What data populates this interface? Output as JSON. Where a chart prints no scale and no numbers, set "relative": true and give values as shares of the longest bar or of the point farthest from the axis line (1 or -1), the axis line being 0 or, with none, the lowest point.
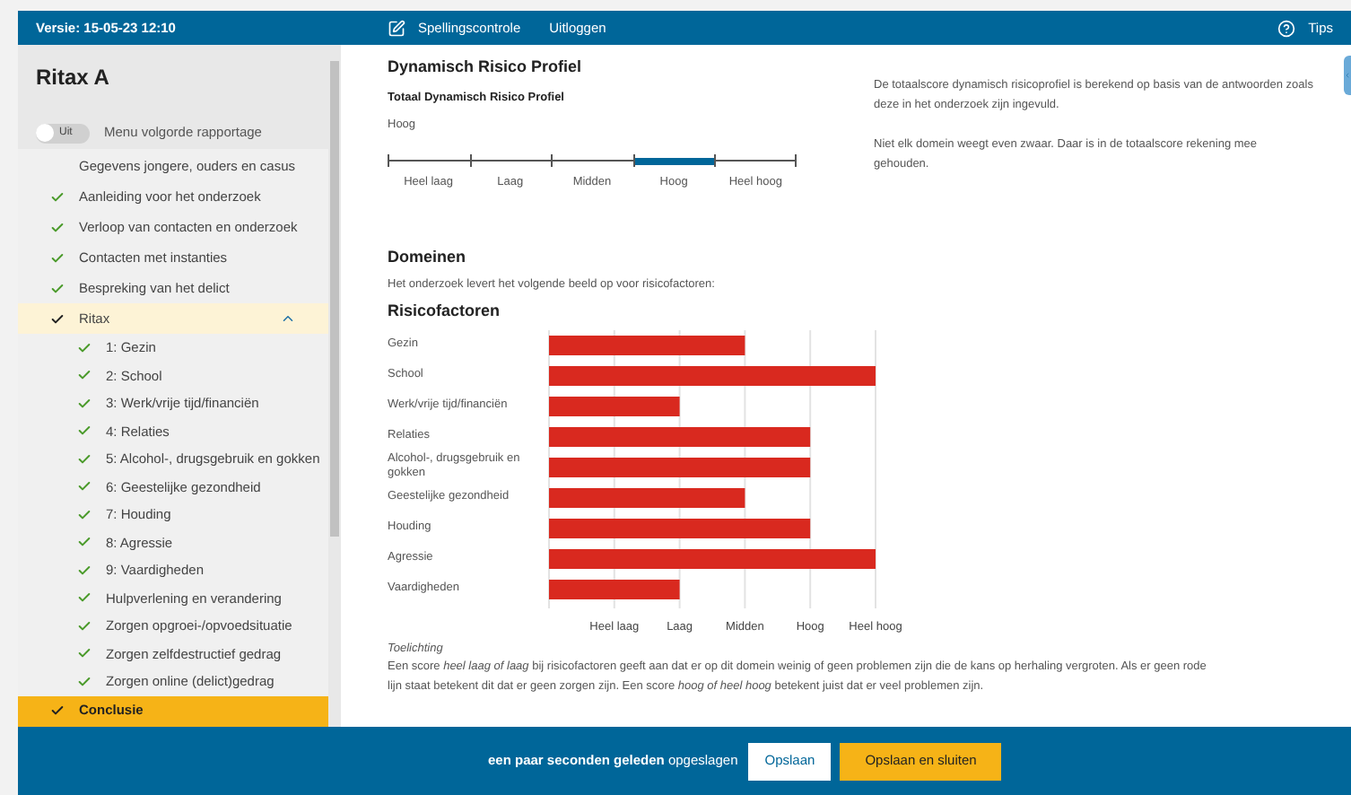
{
  "header": {
    "version": "Versie: 15-05-23 12:10",
    "links": [
      "Spellingscontrole",
      "Uitloggen"
    ],
    "tips": "Tips"
  },
  "sidebar": {
    "title": "Ritax A",
    "toggle": {
      "state": "Uit",
      "on": false,
      "label": "Menu volgorde rapportage"
    },
    "items": [
      {
        "label": "Gegevens jongere, ouders en casus",
        "checked": false,
        "selected": false
      },
      {
        "label": "Aanleiding voor het onderzoek",
        "checked": true,
        "selected": false
      },
      {
        "label": "Verloop van contacten en onderzoek",
        "checked": true,
        "selected": false
      },
      {
        "label": "Contacten met instanties",
        "checked": true,
        "selected": false
      },
      {
        "label": "Bespreking van het delict",
        "checked": true,
        "selected": false
      },
      {
        "label": "Ritax",
        "checked": true,
        "selected": false,
        "expanded": true,
        "children": [
          {
            "label": "1: Gezin",
            "checked": true,
            "selected": false
          },
          {
            "label": "2: School",
            "checked": true,
            "selected": false
          },
          {
            "label": "3: Werk/vrije tijd/financiën",
            "checked": true,
            "selected": false
          },
          {
            "label": "4: Relaties",
            "checked": true,
            "selected": false
          },
          {
            "label": "5: Alcohol-, drugsgebruik en gokken",
            "checked": true,
            "selected": false
          },
          {
            "label": "6: Geestelijke gezondheid",
            "checked": true,
            "selected": false
          },
          {
            "label": "7: Houding",
            "checked": true,
            "selected": false
          },
          {
            "label": "8: Agressie",
            "checked": true,
            "selected": false
          },
          {
            "label": "9: Vaardigheden",
            "checked": true,
            "selected": false
          },
          {
            "label": "Hulpverlening en verandering",
            "checked": true,
            "selected": false
          },
          {
            "label": "Zorgen opgroei-/opvoedsituatie",
            "checked": true,
            "selected": false
          },
          {
            "label": "Zorgen zelfdestructief gedrag",
            "checked": true,
            "selected": false
          },
          {
            "label": "Zorgen online (delict)gedrag",
            "checked": true,
            "selected": false
          }
        ]
      },
      {
        "label": "Conclusie",
        "checked": true,
        "selected": true
      }
    ]
  },
  "profile": {
    "title": "Dynamisch Risico Profiel",
    "subtitle": "Totaal Dynamisch Risico Profiel",
    "value": "Hoog",
    "segments": [
      {
        "label": "Heel laag",
        "selected": false
      },
      {
        "label": "Laag",
        "selected": false
      },
      {
        "label": "Midden",
        "selected": false
      },
      {
        "label": "Hoog",
        "selected": true
      },
      {
        "label": "Heel hoog",
        "selected": false
      }
    ],
    "info": [
      "De totaalscore dynamisch risicoprofiel is berekend op basis van de antwoorden zoals deze in het onderzoek zijn ingevuld.",
      "Niet elk domein weegt even zwaar. Daar is in de totaalscore rekening mee gehouden."
    ]
  },
  "domains": {
    "title": "Domeinen",
    "intro": "Het onderzoek levert het volgende beeld op voor risicofactoren:",
    "chart_data": {
      "type": "bar",
      "orientation": "horizontal",
      "title": "Risicofactoren",
      "categories": [
        "Gezin",
        "School",
        "Werk/vrije tijd/financiën",
        "Relaties",
        "Alcohol-, drugsgebruik en gokken",
        "Geestelijke gezondheid",
        "Houding",
        "Agressie",
        "Vaardigheden"
      ],
      "values": [
        0.6,
        1,
        0.4,
        0.8,
        0.8,
        0.6,
        0.8,
        1,
        0.4
      ],
      "relative": true
    },
    "axis_levels": [
      "Heel laag",
      "Laag",
      "Midden",
      "Hoog",
      "Heel hoog"
    ],
    "note_title": "Toelichting",
    "note": "Een score *heel laag of laag* bij risicofactoren geeft aan dat er op dit domein weinig of geen problemen zijn die de kans op herhaling vergroten. Als er geen rode lijn staat betekent dit dat er geen zorgen zijn. Een score *hoog of heel hoog* betekent juist dat er veel problemen zijn."
  },
  "footer": {
    "status": "**een paar seconden geleden** opgeslagen",
    "buttons": [
      "Opslaan",
      "Opslaan en sluiten"
    ]
  }
}
